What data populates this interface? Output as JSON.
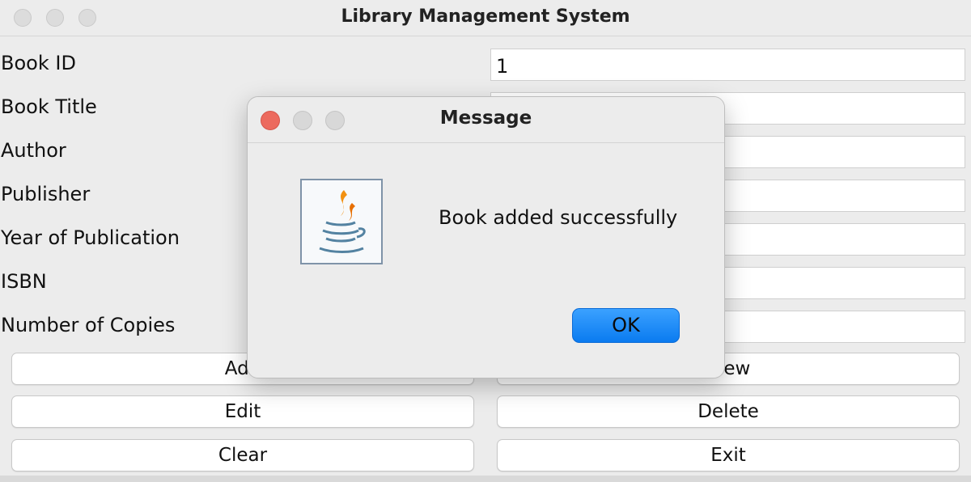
{
  "window": {
    "title": "Library Management System"
  },
  "form": {
    "fields": [
      {
        "label": "Book ID",
        "value": "1"
      },
      {
        "label": "Book Title",
        "value": ""
      },
      {
        "label": "Author",
        "value": ""
      },
      {
        "label": "Publisher",
        "value": ""
      },
      {
        "label": "Year of Publication",
        "value": ""
      },
      {
        "label": "ISBN",
        "value": ""
      },
      {
        "label": "Number of Copies",
        "value": ""
      }
    ]
  },
  "buttons": {
    "add": "Add",
    "view": "View",
    "edit": "Edit",
    "delete": "Delete",
    "clear": "Clear",
    "exit": "Exit"
  },
  "dialog": {
    "title": "Message",
    "message": "Book added successfully",
    "ok_label": "OK",
    "icon": "java-coffee-cup-icon",
    "close_color": "#ec6a5e",
    "ok_color": "#1682f6"
  }
}
